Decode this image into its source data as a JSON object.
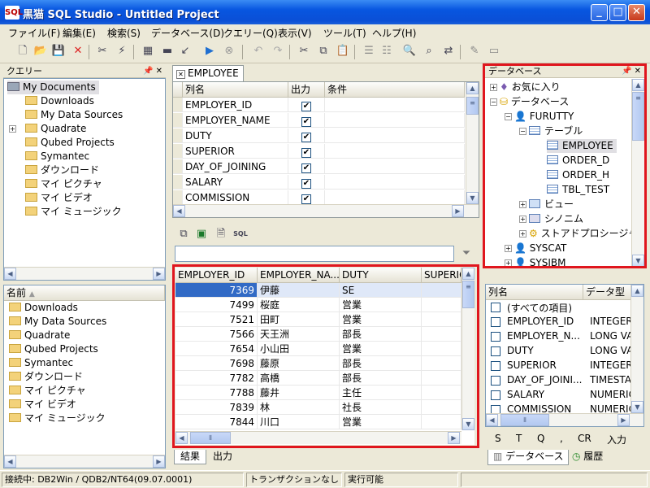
{
  "window": {
    "title": "黒猫 SQL Studio - Untitled Project",
    "icon_text": "SQL",
    "minimize": "_",
    "maximize": "□",
    "close": "✕"
  },
  "menu": [
    "ファイル(F)",
    "編集(E)",
    "検索(S)",
    "データベース(D)",
    "クエリー(Q)",
    "表示(V)",
    "ツール(T)",
    "ヘルプ(H)"
  ],
  "query_panel": {
    "title": "クエリー",
    "items": [
      "My Documents",
      "Downloads",
      "My Data Sources",
      "Quadrate",
      "Qubed Projects",
      "Symantec",
      "ダウンロード",
      "マイ ピクチャ",
      "マイ ビデオ",
      "マイ ミュージック"
    ]
  },
  "name_panel": {
    "header": "名前",
    "items": [
      "Downloads",
      "My Data Sources",
      "Quadrate",
      "Qubed Projects",
      "Symantec",
      "ダウンロード",
      "マイ ピクチャ",
      "マイ ビデオ",
      "マイ ミュージック"
    ]
  },
  "editor_tab": "EMPLOYEE",
  "design_grid": {
    "headers": [
      "列名",
      "出力",
      "条件"
    ],
    "rows": [
      "EMPLOYER_ID",
      "EMPLOYER_NAME",
      "DUTY",
      "SUPERIOR",
      "DAY_OF_JOINING",
      "SALARY",
      "COMMISSION"
    ]
  },
  "result_grid": {
    "headers": [
      "EMPLOYER_ID",
      "EMPLOYER_NA...",
      "DUTY",
      "SUPERIO"
    ],
    "rows": [
      [
        "7369",
        "伊藤",
        "SE"
      ],
      [
        "7499",
        "桜庭",
        "営業"
      ],
      [
        "7521",
        "田町",
        "営業"
      ],
      [
        "7566",
        "天王洲",
        "部長"
      ],
      [
        "7654",
        "小山田",
        "営業"
      ],
      [
        "7698",
        "藤原",
        "部長"
      ],
      [
        "7782",
        "高橋",
        "部長"
      ],
      [
        "7788",
        "藤井",
        "主任"
      ],
      [
        "7839",
        "林",
        "社長"
      ],
      [
        "7844",
        "川口",
        "営業"
      ]
    ]
  },
  "result_tabs": [
    "結果",
    "出力"
  ],
  "db_panel": {
    "title": "データベース",
    "tree": [
      "お気に入り",
      "データベース",
      "FURUTTY",
      "テーブル",
      "EMPLOYEE",
      "ORDER_D",
      "ORDER_H",
      "TBL_TEST",
      "ビュー",
      "シノニム",
      "ストアドプロシージャ",
      "SYSCAT",
      "SYSIBM"
    ]
  },
  "column_panel": {
    "headers": [
      "列名",
      "データ型"
    ],
    "rows": [
      [
        "(すべての項目)",
        ""
      ],
      [
        "EMPLOYER_ID",
        "INTEGER"
      ],
      [
        "EMPLOYER_N...",
        "LONG VA"
      ],
      [
        "DUTY",
        "LONG VA"
      ],
      [
        "SUPERIOR",
        "INTEGER"
      ],
      [
        "DAY_OF_JOINI...",
        "TIMESTA"
      ],
      [
        "SALARY",
        "NUMERIC"
      ],
      [
        "COMMISSION",
        "NUMERIC"
      ]
    ]
  },
  "letter_bar": [
    "S",
    "T",
    "Q",
    ",",
    "CR",
    "入力"
  ],
  "bottom_tabs": [
    "データベース",
    "履歴"
  ],
  "status": [
    "接続中: DB2Win / QDB2/NT64(09.07.0001)",
    "トランザクションなし",
    "実行可能"
  ],
  "colors": {
    "highlight_red": "#E0161E",
    "selected_row": "#316AC5",
    "title_blue": "#0A4FD6"
  }
}
